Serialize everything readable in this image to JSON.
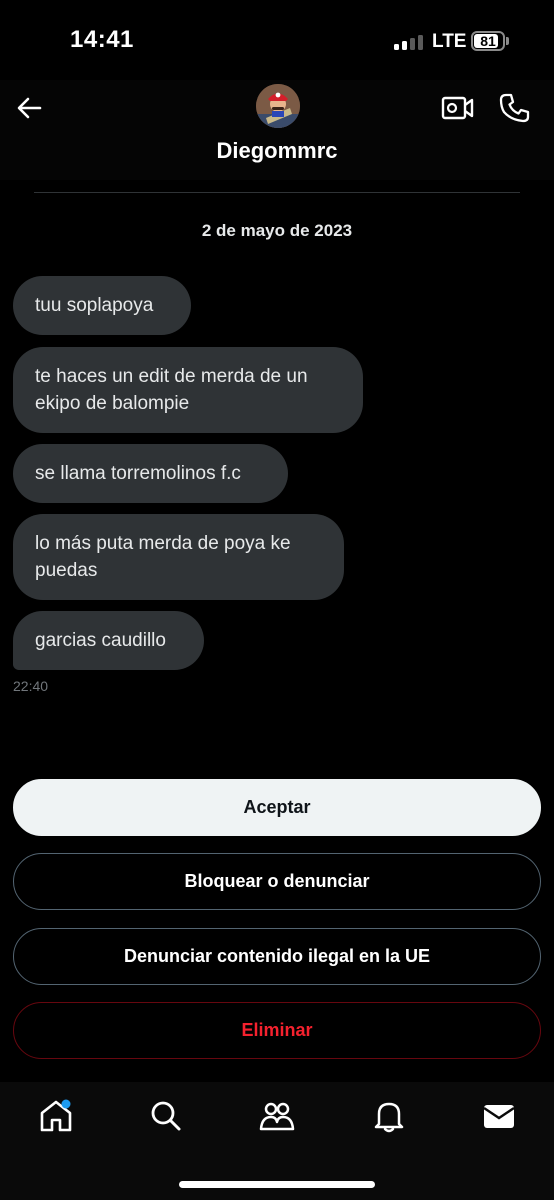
{
  "status_bar": {
    "time": "14:41",
    "network": "LTE",
    "battery": "81",
    "battery_level": 0.81
  },
  "header": {
    "contact_name": "Diegommrc",
    "back_icon": "arrow-left-icon",
    "video_icon": "video-camera-icon",
    "call_icon": "phone-icon"
  },
  "conversation": {
    "date": "2 de mayo de 2023",
    "messages": [
      {
        "text": "tuu soplapoya"
      },
      {
        "text": "te haces un edit de merda de un ekipo de balompie"
      },
      {
        "text": "se llama torremolinos f.c"
      },
      {
        "text": "lo más puta merda de poya ke puedas"
      },
      {
        "text": "garcias caudillo"
      }
    ],
    "timestamp": "22:40"
  },
  "actions": {
    "accept": "Aceptar",
    "block_report": "Bloquear o denunciar",
    "report_illegal": "Denunciar contenido ilegal en la UE",
    "delete": "Eliminar"
  },
  "tab_bar": {
    "items": [
      "home-icon",
      "search-icon",
      "communities-icon",
      "notifications-icon",
      "messages-icon"
    ],
    "notification_dot_color": "#1d9bf0"
  },
  "colors": {
    "bubble": "#2f3336",
    "danger": "#f4212e",
    "muted": "#71767b"
  }
}
